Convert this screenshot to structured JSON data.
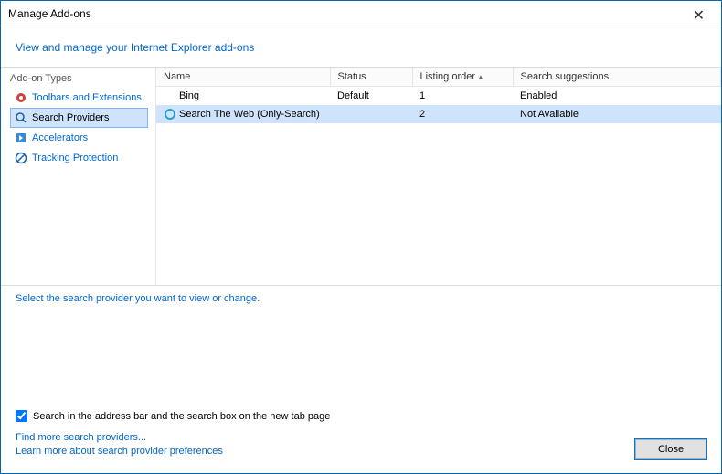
{
  "window": {
    "title": "Manage Add-ons",
    "subtitle_link": "View and manage your Internet Explorer add-ons"
  },
  "sidebar": {
    "heading": "Add-on Types",
    "items": [
      {
        "label": "Toolbars and Extensions",
        "icon": "extensions-icon"
      },
      {
        "label": "Search Providers",
        "icon": "search-icon"
      },
      {
        "label": "Accelerators",
        "icon": "accelerator-icon"
      },
      {
        "label": "Tracking Protection",
        "icon": "tracking-icon"
      }
    ],
    "selected_index": 1
  },
  "table": {
    "columns": [
      {
        "label": "Name",
        "sort": ""
      },
      {
        "label": "Status",
        "sort": ""
      },
      {
        "label": "Listing order",
        "sort": "asc"
      },
      {
        "label": "Search suggestions",
        "sort": ""
      }
    ],
    "rows": [
      {
        "name": "Bing",
        "status": "Default",
        "order": "1",
        "suggestions": "Enabled",
        "icon": "bing-icon",
        "selected": false
      },
      {
        "name": "Search The Web (Only-Search)",
        "status": "",
        "order": "2",
        "suggestions": "Not Available",
        "icon": "ring-icon",
        "selected": true
      }
    ]
  },
  "info": {
    "prompt": "Select the search provider you want to view or change."
  },
  "footer": {
    "checkbox_label": "Search in the address bar and the search box on the new tab page",
    "checkbox_checked": true,
    "link_find": "Find more search providers...",
    "link_learn": "Learn more about search provider preferences",
    "close_button": "Close"
  }
}
